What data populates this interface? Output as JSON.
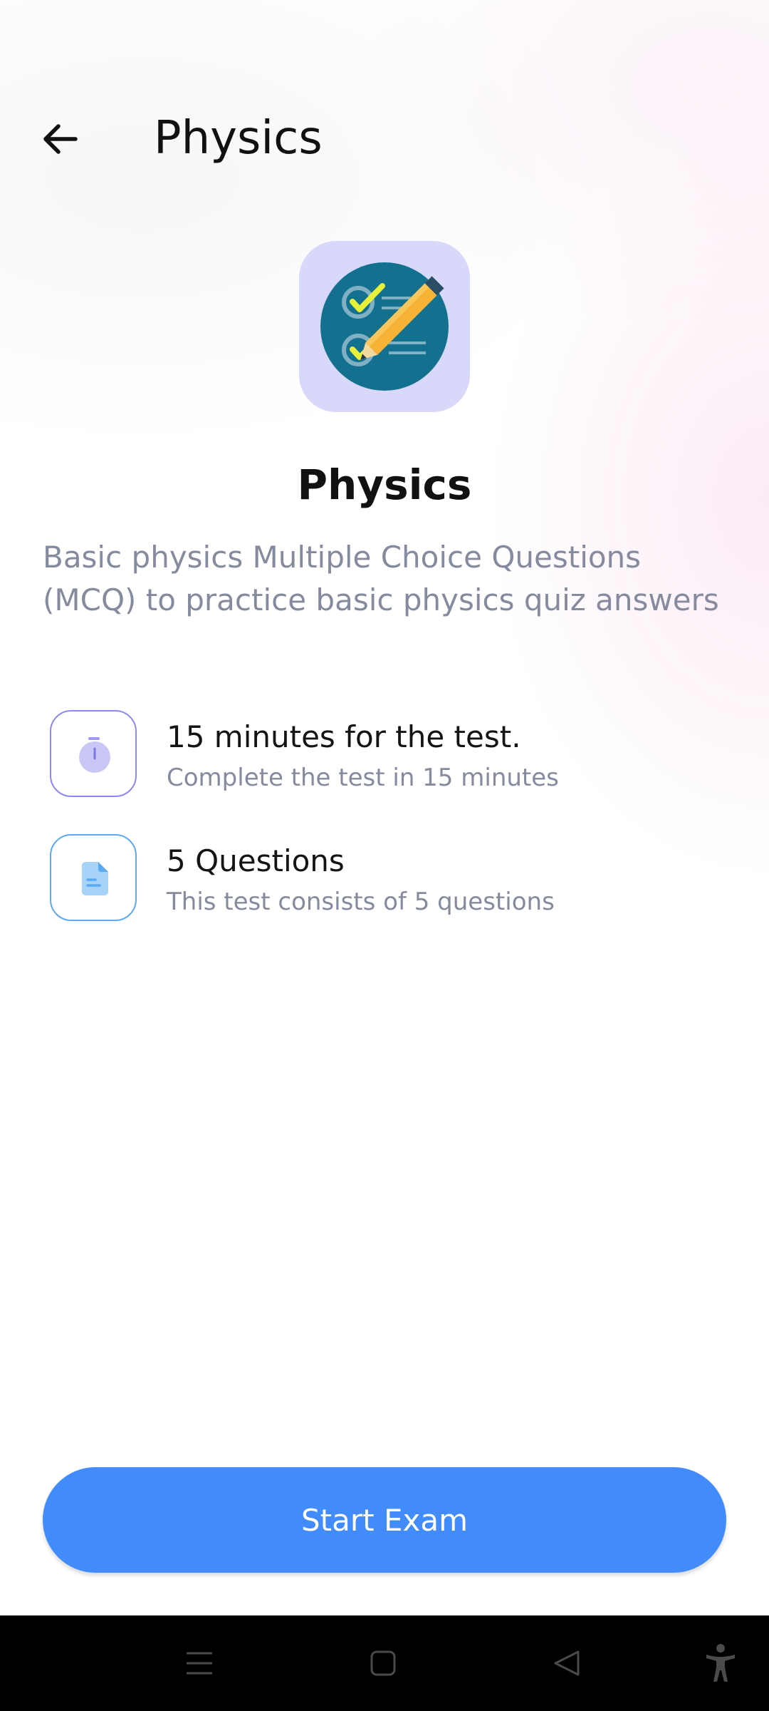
{
  "appbar": {
    "title": "Physics"
  },
  "hero": {
    "icon": "checklist-pencil-icon",
    "title": "Physics",
    "description": "Basic physics Multiple Choice Questions (MCQ) to practice basic physics quiz answers"
  },
  "info": [
    {
      "icon": "stopwatch-icon",
      "title": "15 minutes for the test.",
      "subtitle": "Complete the test in 15 minutes"
    },
    {
      "icon": "document-icon",
      "title": "5 Questions",
      "subtitle": "This test consists of 5 questions"
    }
  ],
  "actions": {
    "start_label": "Start Exam"
  },
  "navbar": {
    "icons": [
      "menu-icon",
      "home-square-icon",
      "back-triangle-icon",
      "accessibility-icon"
    ]
  },
  "colors": {
    "primary": "#418cfa",
    "icon_bg": "#d8d8fb",
    "text_secondary": "#858a9e",
    "timer_border": "#8d88ef",
    "doc_border": "#5aaaf3"
  }
}
